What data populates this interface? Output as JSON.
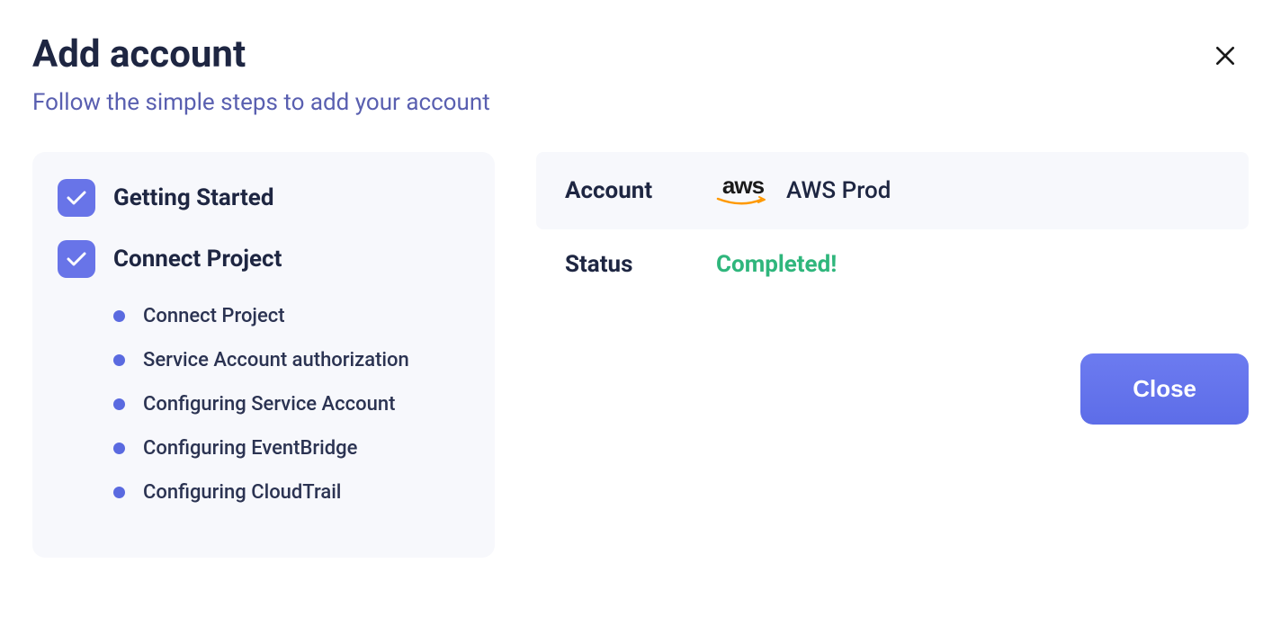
{
  "header": {
    "title": "Add account",
    "subtitle": "Follow the simple steps to add your account"
  },
  "sidebar": {
    "steps": [
      {
        "label": "Getting Started",
        "completed": true,
        "substeps": []
      },
      {
        "label": "Connect Project",
        "completed": true,
        "substeps": [
          "Connect Project",
          "Service Account authorization",
          "Configuring Service Account",
          "Configuring EventBridge",
          "Configuring CloudTrail"
        ]
      }
    ]
  },
  "main": {
    "account_label": "Account",
    "account_provider": "aws",
    "account_name": "AWS Prod",
    "status_label": "Status",
    "status_value": "Completed!"
  },
  "actions": {
    "close_label": "Close"
  }
}
